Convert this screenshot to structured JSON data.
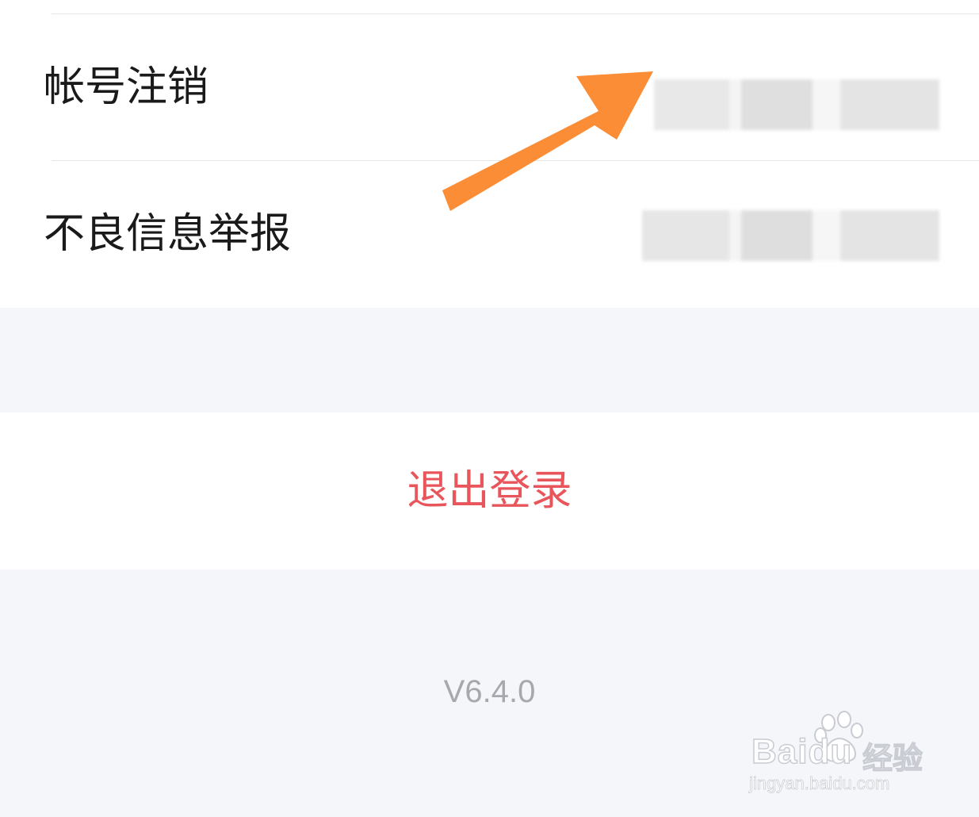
{
  "settings": {
    "items": [
      {
        "label": "帐号注销"
      },
      {
        "label": "不良信息举报"
      }
    ]
  },
  "logout": {
    "label": "退出登录",
    "color": "#e8555a"
  },
  "footer": {
    "version": "V6.4.0"
  },
  "annotation": {
    "arrow_color": "#fa8d35"
  },
  "watermark": {
    "brand": "Baidu",
    "product": "经验",
    "url": "jingyan.baidu.com"
  }
}
